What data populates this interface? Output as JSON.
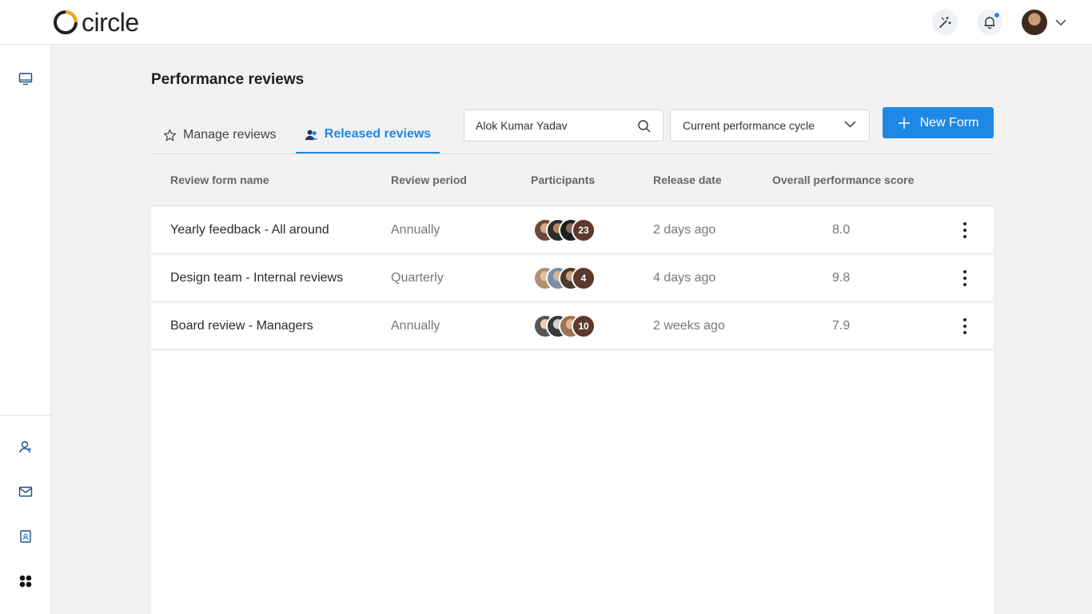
{
  "app": {
    "logo_text": "circle"
  },
  "header": {
    "icons": [
      "magic-wand-icon",
      "bell-icon"
    ],
    "notification_dot": true
  },
  "sidebar": {
    "top_items": [
      "monitor-icon"
    ],
    "bottom_items": [
      "add-user-icon",
      "mail-icon",
      "badge-icon",
      "apps-icon"
    ]
  },
  "page": {
    "title": "Performance reviews",
    "tabs": [
      {
        "label": "Manage reviews",
        "icon": "star-icon",
        "active": false
      },
      {
        "label": "Released reviews",
        "icon": "users-icon",
        "active": true
      }
    ],
    "search": {
      "value": "Alok Kumar Yadav",
      "placeholder": ""
    },
    "cycle_select": {
      "value": "Current performance cycle"
    },
    "new_button": {
      "label": "New Form"
    }
  },
  "table": {
    "columns": [
      "Review form name",
      "Review period",
      "Participants",
      "Release date",
      "Overall performance score"
    ],
    "rows": [
      {
        "name": "Yearly feedback - All around",
        "period": "Annually",
        "participants_count": "23",
        "release_date": "2 days ago",
        "score": "8.0"
      },
      {
        "name": "Design team - Internal reviews",
        "period": "Quarterly",
        "participants_count": "4",
        "release_date": "4 days ago",
        "score": "9.8"
      },
      {
        "name": "Board review - Managers",
        "period": "Annually",
        "participants_count": "10",
        "release_date": "2 weeks ago",
        "score": "7.9"
      }
    ]
  },
  "colors": {
    "accent": "#1f88e5",
    "logo_ring": "#f0a51e"
  }
}
